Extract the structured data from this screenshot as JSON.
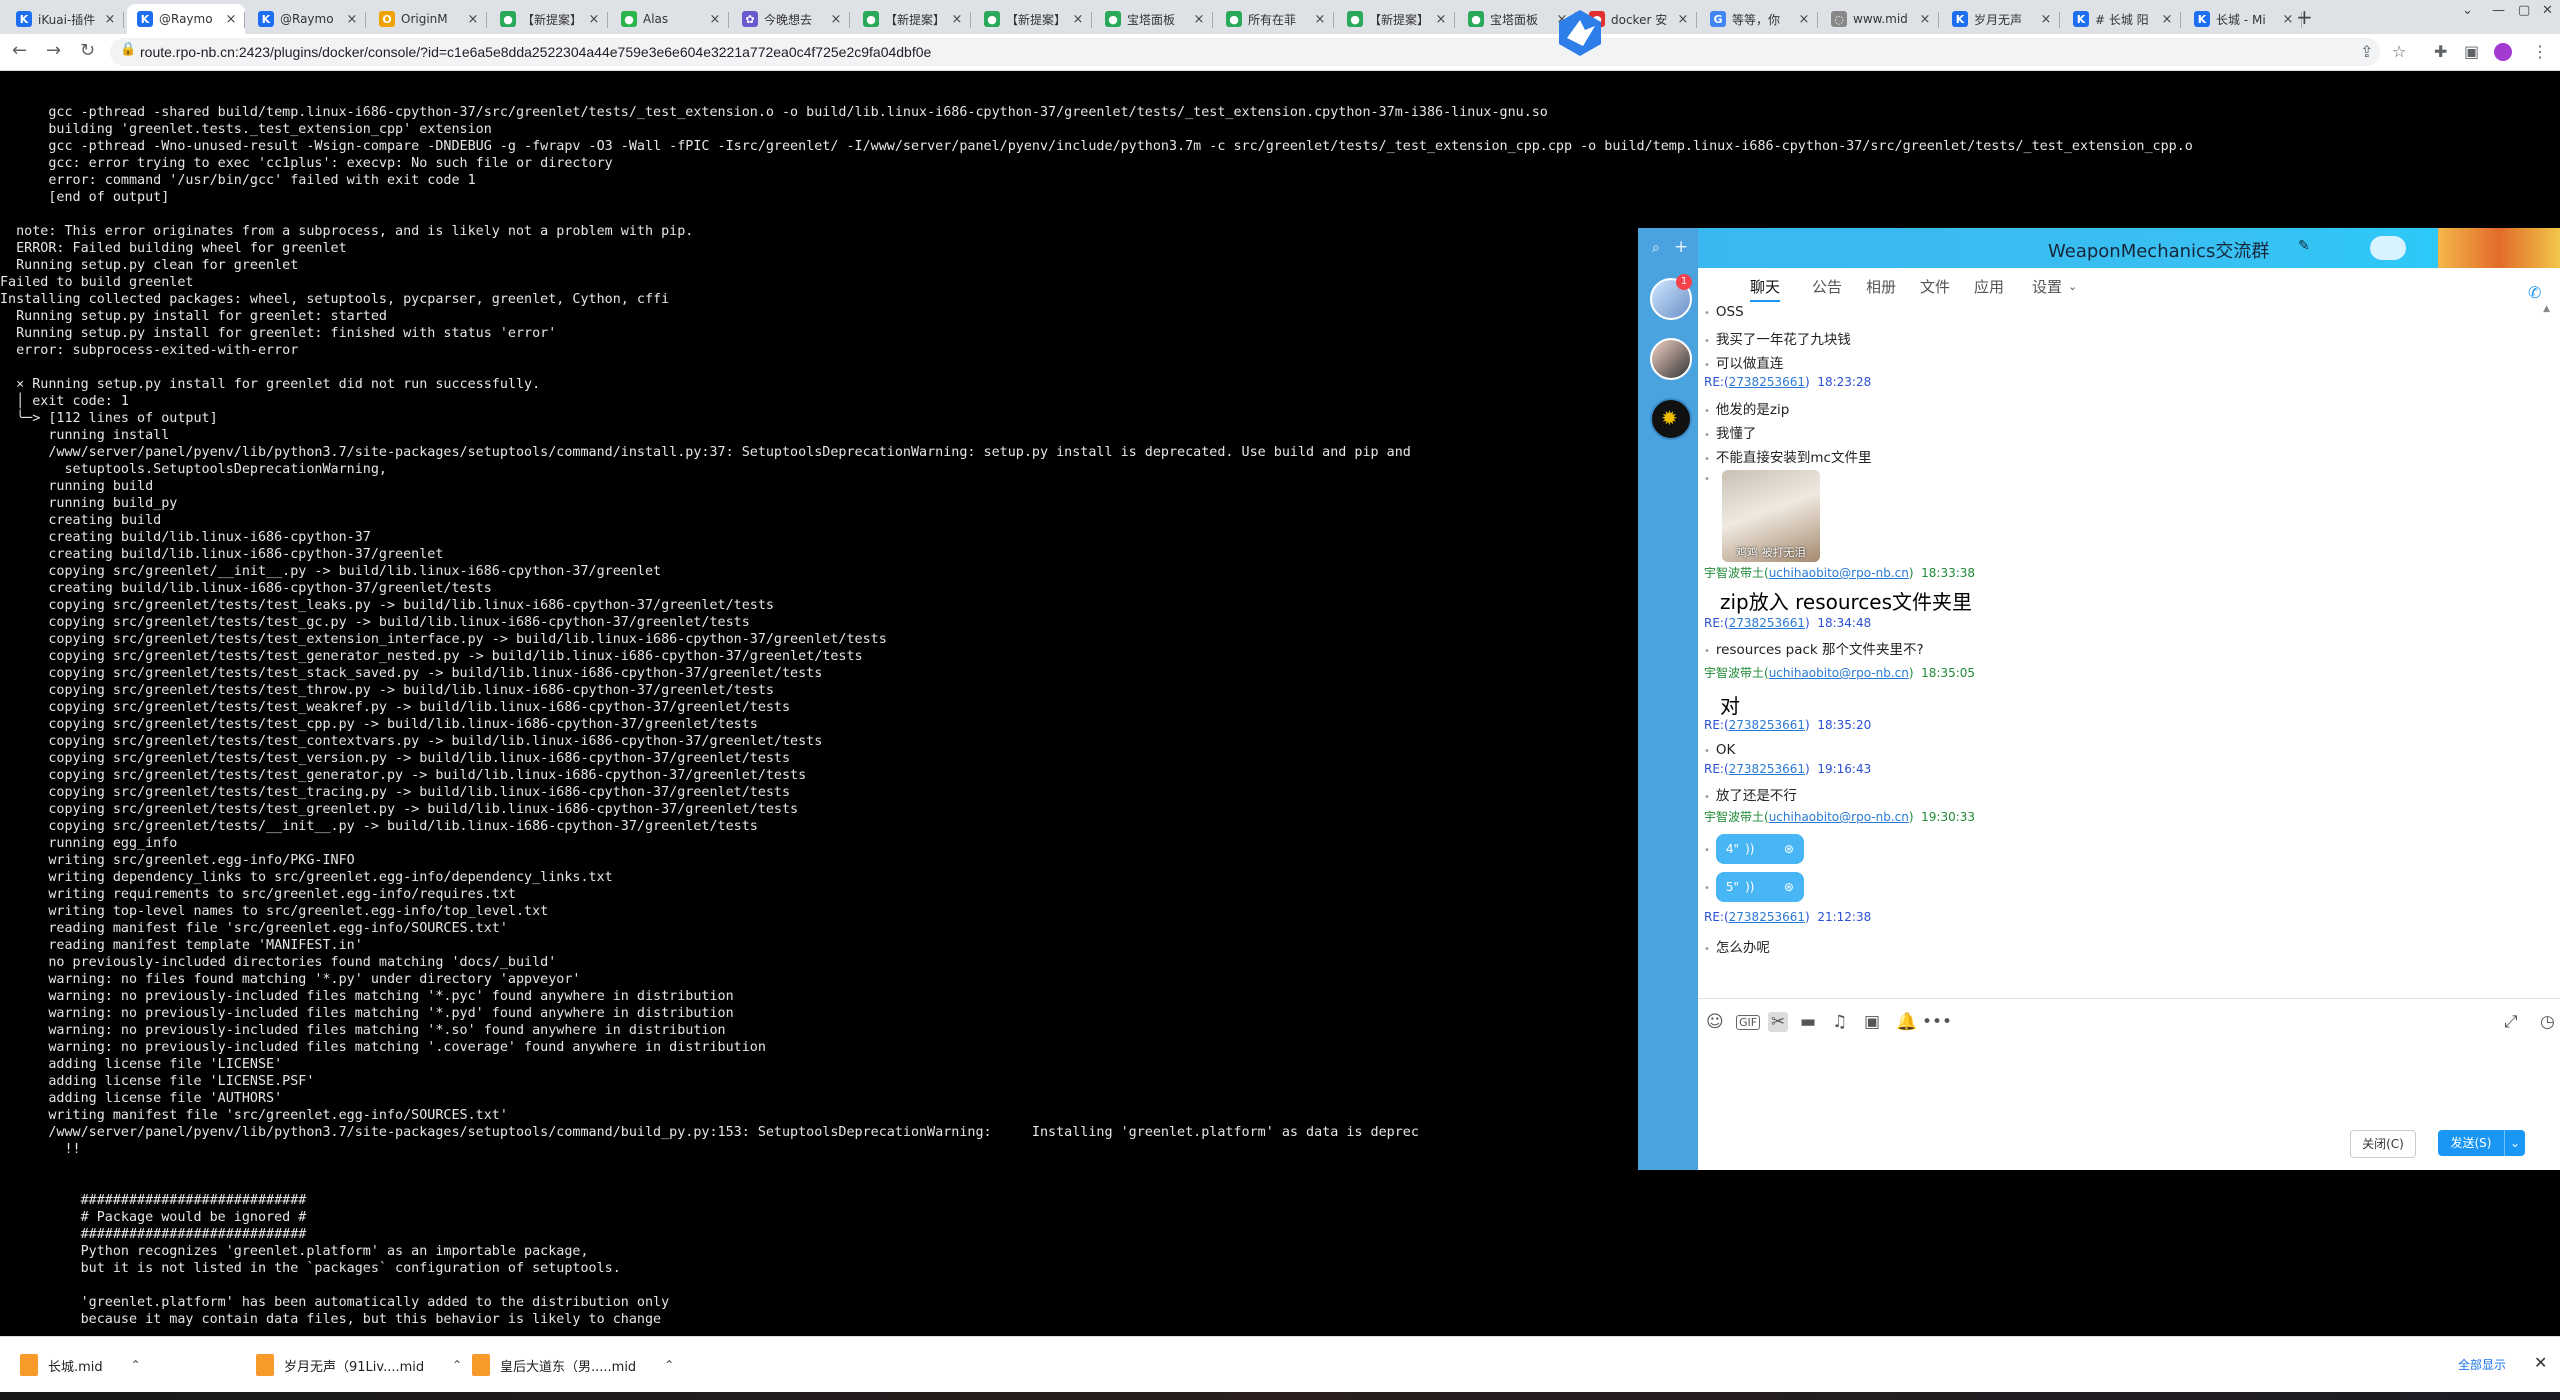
{
  "tabs": [
    {
      "title": "iKuai-插件",
      "color": "#1e6ff0",
      "glyph": "K"
    },
    {
      "title": "@Raymo",
      "color": "#1e6ff0",
      "glyph": "K",
      "active": true
    },
    {
      "title": "@Raymo",
      "color": "#1e6ff0",
      "glyph": "K"
    },
    {
      "title": "OriginM",
      "color": "#f0a300",
      "glyph": "O"
    },
    {
      "title": "【新提案】",
      "color": "#2aa95a",
      "glyph": "●"
    },
    {
      "title": "Alas",
      "color": "#2ab54a",
      "glyph": "●"
    },
    {
      "title": "今晚想去",
      "color": "#6a5acd",
      "glyph": "✿"
    },
    {
      "title": "【新提案】",
      "color": "#2aa95a",
      "glyph": "●"
    },
    {
      "title": "【新提案】",
      "color": "#2aa95a",
      "glyph": "●"
    },
    {
      "title": "宝塔面板",
      "color": "#2aa95a",
      "glyph": "●"
    },
    {
      "title": "所有在菲",
      "color": "#2aa95a",
      "glyph": "●"
    },
    {
      "title": "【新提案】",
      "color": "#2aa95a",
      "glyph": "●"
    },
    {
      "title": "宝塔面板",
      "color": "#2aa95a",
      "glyph": "●"
    },
    {
      "title": "docker 安",
      "color": "#e03030",
      "glyph": "●"
    },
    {
      "title": "等等，你",
      "color": "#4285f4",
      "glyph": "G"
    },
    {
      "title": "www.mid",
      "color": "#888888",
      "glyph": "◌"
    },
    {
      "title": "岁月无声",
      "color": "#1e6ff0",
      "glyph": "K"
    },
    {
      "title": "# 长城 阳",
      "color": "#1e6ff0",
      "glyph": "K"
    },
    {
      "title": "长城 - Mi",
      "color": "#1e6ff0",
      "glyph": "K"
    }
  ],
  "address": {
    "url": "route.rpo-nb.cn:2423/plugins/docker/console/?id=c1e6a5e8dda2522304a44e759e3e6e604e3221a772ea0c4f725e2c9fa04dbf0e"
  },
  "terminal": {
    "lines": [
      "      gcc -pthread -shared build/temp.linux-i686-cpython-37/src/greenlet/tests/_test_extension.o -o build/lib.linux-i686-cpython-37/greenlet/tests/_test_extension.cpython-37m-i386-linux-gnu.so",
      "      building 'greenlet.tests._test_extension_cpp' extension",
      "      gcc -pthread -Wno-unused-result -Wsign-compare -DNDEBUG -g -fwrapv -O3 -Wall -fPIC -Isrc/greenlet/ -I/www/server/panel/pyenv/include/python3.7m -c src/greenlet/tests/_test_extension_cpp.cpp -o build/temp.linux-i686-cpython-37/src/greenlet/tests/_test_extension_cpp.o",
      "      gcc: error trying to exec 'cc1plus': execvp: No such file or directory",
      "      error: command '/usr/bin/gcc' failed with exit code 1",
      "      [end of output]",
      "",
      "  note: This error originates from a subprocess, and is likely not a problem with pip.",
      "  ERROR: Failed building wheel for greenlet",
      "  Running setup.py clean for greenlet",
      "Failed to build greenlet",
      "Installing collected packages: wheel, setuptools, pycparser, greenlet, Cython, cffi",
      "  Running setup.py install for greenlet: started",
      "  Running setup.py install for greenlet: finished with status 'error'",
      "  error: subprocess-exited-with-error",
      "",
      "  × Running setup.py install for greenlet did not run successfully.",
      "  │ exit code: 1",
      "  ╰─> [112 lines of output]",
      "      running install",
      "      /www/server/panel/pyenv/lib/python3.7/site-packages/setuptools/command/install.py:37: SetuptoolsDeprecationWarning: setup.py install is deprecated. Use build and pip and",
      "        setuptools.SetuptoolsDeprecationWarning,",
      "      running build",
      "      running build_py",
      "      creating build",
      "      creating build/lib.linux-i686-cpython-37",
      "      creating build/lib.linux-i686-cpython-37/greenlet",
      "      copying src/greenlet/__init__.py -> build/lib.linux-i686-cpython-37/greenlet",
      "      creating build/lib.linux-i686-cpython-37/greenlet/tests",
      "      copying src/greenlet/tests/test_leaks.py -> build/lib.linux-i686-cpython-37/greenlet/tests",
      "      copying src/greenlet/tests/test_gc.py -> build/lib.linux-i686-cpython-37/greenlet/tests",
      "      copying src/greenlet/tests/test_extension_interface.py -> build/lib.linux-i686-cpython-37/greenlet/tests",
      "      copying src/greenlet/tests/test_generator_nested.py -> build/lib.linux-i686-cpython-37/greenlet/tests",
      "      copying src/greenlet/tests/test_stack_saved.py -> build/lib.linux-i686-cpython-37/greenlet/tests",
      "      copying src/greenlet/tests/test_throw.py -> build/lib.linux-i686-cpython-37/greenlet/tests",
      "      copying src/greenlet/tests/test_weakref.py -> build/lib.linux-i686-cpython-37/greenlet/tests",
      "      copying src/greenlet/tests/test_cpp.py -> build/lib.linux-i686-cpython-37/greenlet/tests",
      "      copying src/greenlet/tests/test_contextvars.py -> build/lib.linux-i686-cpython-37/greenlet/tests",
      "      copying src/greenlet/tests/test_version.py -> build/lib.linux-i686-cpython-37/greenlet/tests",
      "      copying src/greenlet/tests/test_generator.py -> build/lib.linux-i686-cpython-37/greenlet/tests",
      "      copying src/greenlet/tests/test_tracing.py -> build/lib.linux-i686-cpython-37/greenlet/tests",
      "      copying src/greenlet/tests/test_greenlet.py -> build/lib.linux-i686-cpython-37/greenlet/tests",
      "      copying src/greenlet/tests/__init__.py -> build/lib.linux-i686-cpython-37/greenlet/tests",
      "      running egg_info",
      "      writing src/greenlet.egg-info/PKG-INFO",
      "      writing dependency_links to src/greenlet.egg-info/dependency_links.txt",
      "      writing requirements to src/greenlet.egg-info/requires.txt",
      "      writing top-level names to src/greenlet.egg-info/top_level.txt",
      "      reading manifest file 'src/greenlet.egg-info/SOURCES.txt'",
      "      reading manifest template 'MANIFEST.in'",
      "      no previously-included directories found matching 'docs/_build'",
      "      warning: no files found matching '*.py' under directory 'appveyor'",
      "      warning: no previously-included files matching '*.pyc' found anywhere in distribution",
      "      warning: no previously-included files matching '*.pyd' found anywhere in distribution",
      "      warning: no previously-included files matching '*.so' found anywhere in distribution",
      "      warning: no previously-included files matching '.coverage' found anywhere in distribution",
      "      adding license file 'LICENSE'",
      "      adding license file 'LICENSE.PSF'",
      "      adding license file 'AUTHORS'",
      "      writing manifest file 'src/greenlet.egg-info/SOURCES.txt'",
      "      /www/server/panel/pyenv/lib/python3.7/site-packages/setuptools/command/build_py.py:153: SetuptoolsDeprecationWarning:     Installing 'greenlet.platform' as data is deprec",
      "        !!",
      "",
      "",
      "          ############################",
      "          # Package would be ignored #",
      "          ############################",
      "          Python recognizes 'greenlet.platform' as an importable package,",
      "          but it is not listed in the `packages` configuration of setuptools.",
      "",
      "          'greenlet.platform' has been automatically added to the distribution only",
      "          because it may contain data files, but this behavior is likely to change"
    ]
  },
  "chat": {
    "title": "WeaponMechanics交流群",
    "tabs": [
      "聊天",
      "公告",
      "相册",
      "文件",
      "应用",
      "设置"
    ],
    "messages": [
      {
        "kind": "text",
        "text": "OSS"
      },
      {
        "kind": "text",
        "text": "我买了一年花了九块钱"
      },
      {
        "kind": "text",
        "text": "可以做直连"
      },
      {
        "kind": "meta-re",
        "name": "RE:",
        "id": "2738253661",
        "time": "18:23:28"
      },
      {
        "kind": "text",
        "text": "他发的是zip"
      },
      {
        "kind": "text",
        "text": "我懂了"
      },
      {
        "kind": "text",
        "text": "不能直接安装到mc文件里"
      },
      {
        "kind": "image",
        "caption": "鸡鸡 被打无泪"
      },
      {
        "kind": "meta-yz",
        "name": "宇智波带土",
        "id": "uchihaobito@rpo-nb.cn",
        "time": "18:33:38"
      },
      {
        "kind": "big",
        "text": "zip放入 resources文件夹里"
      },
      {
        "kind": "meta-re",
        "name": "RE:",
        "id": "2738253661",
        "time": "18:34:48"
      },
      {
        "kind": "text",
        "text": "resources pack 那个文件夹里不?"
      },
      {
        "kind": "meta-yz",
        "name": "宇智波带土",
        "id": "uchihaobito@rpo-nb.cn",
        "time": "18:35:05"
      },
      {
        "kind": "big",
        "text": "对"
      },
      {
        "kind": "meta-re",
        "name": "RE:",
        "id": "2738253661",
        "time": "18:35:20"
      },
      {
        "kind": "text",
        "text": "OK"
      },
      {
        "kind": "meta-re",
        "name": "RE:",
        "id": "2738253661",
        "time": "19:16:43"
      },
      {
        "kind": "text",
        "text": "放了还是不行"
      },
      {
        "kind": "meta-yz",
        "name": "宇智波带土",
        "id": "uchihaobito@rpo-nb.cn",
        "time": "19:30:33"
      },
      {
        "kind": "voice",
        "duration": "4\""
      },
      {
        "kind": "voice",
        "duration": "5\""
      },
      {
        "kind": "meta-re",
        "name": "RE:",
        "id": "2738253661",
        "time": "21:12:38"
      },
      {
        "kind": "text",
        "text": "怎么办呢"
      }
    ],
    "buttons": {
      "close": "关闭(C)",
      "send": "发送(S)"
    }
  },
  "downloads": {
    "items": [
      "长城.mid",
      "岁月无声（91Liv....mid",
      "皇后大道东（男.....mid"
    ],
    "show_all": "全部显示"
  }
}
